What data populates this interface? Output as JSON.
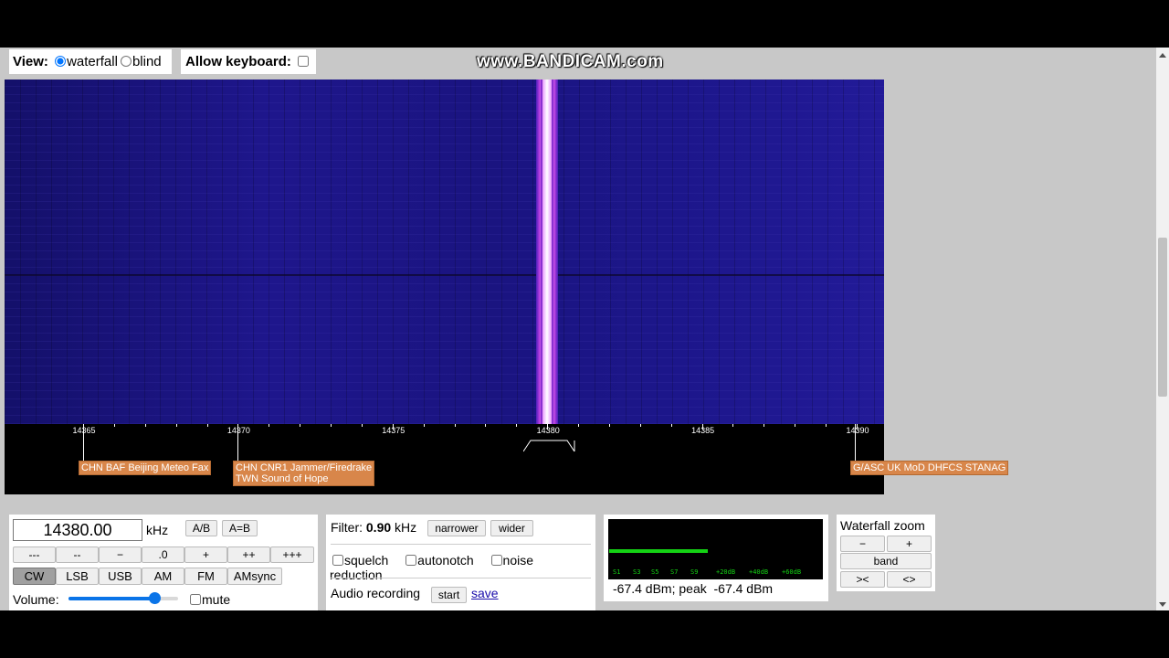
{
  "view": {
    "label": "View:",
    "options": [
      {
        "label": "waterfall",
        "checked": true
      },
      {
        "label": "blind",
        "checked": false
      }
    ]
  },
  "keyboard": {
    "label": "Allow keyboard:",
    "checked": false
  },
  "watermark": "www.BANDICAM.com",
  "scale": {
    "ticks": [
      "14365",
      "14370",
      "14375",
      "14380",
      "14385",
      "14390"
    ],
    "tuned_khz": 14380
  },
  "stations": [
    {
      "lines": [
        "CHN BAF Beijing Meteo Fax"
      ]
    },
    {
      "lines": [
        "CHN CNR1 Jammer/Firedrake",
        "TWN Sound of Hope"
      ]
    },
    {
      "lines": [
        "G/ASC UK MoD DHFCS STANAG"
      ]
    }
  ],
  "frequency": {
    "value": "14380.00",
    "unit": "kHz",
    "ab": "A/B",
    "aeqb": "A=B"
  },
  "step_buttons": [
    "---",
    "--",
    "−",
    ".0",
    "+",
    "++",
    "+++"
  ],
  "modes": [
    {
      "label": "CW",
      "active": true
    },
    {
      "label": "LSB",
      "active": false
    },
    {
      "label": "USB",
      "active": false
    },
    {
      "label": "AM",
      "active": false
    },
    {
      "label": "FM",
      "active": false
    },
    {
      "label": "AMsync",
      "active": false
    }
  ],
  "volume": {
    "label": "Volume:",
    "level": 0.78,
    "mute_label": "mute",
    "muted": false
  },
  "filter": {
    "label": "Filter:",
    "value": "0.90",
    "unit": "kHz",
    "narrower": "narrower",
    "wider": "wider"
  },
  "options": {
    "squelch": "squelch",
    "autonotch": "autonotch",
    "noise_reduction": "noise reduction"
  },
  "recording": {
    "label": "Audio recording",
    "start": "start",
    "save": "save"
  },
  "smeter": {
    "scale": [
      "S1",
      "S3",
      "S5",
      "S7",
      "S9",
      "+20dB",
      "+40dB",
      "+60dB"
    ],
    "level_fraction": 0.46,
    "readout": "-67.4 dBm; peak  -67.4 dBm",
    "bar_color": "#14d214"
  },
  "waterfall_zoom": {
    "title": "Waterfall zoom",
    "minus": "−",
    "plus": "+",
    "band": "band",
    "zoom_in": "><",
    "zoom_out": "<>"
  }
}
